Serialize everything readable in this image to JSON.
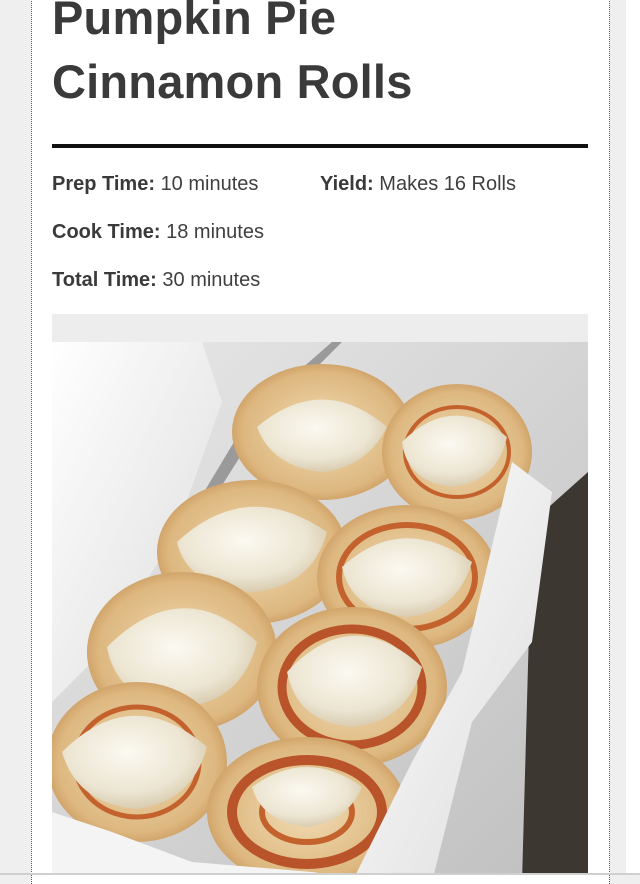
{
  "recipe": {
    "title_line1": "Pumpkin Pie",
    "title_line2": "Cinnamon Rolls",
    "prep_label": "Prep Time:",
    "prep_value": "10 minutes",
    "yield_label": "Yield:",
    "yield_value": "Makes 16 Rolls",
    "cook_label": "Cook Time:",
    "cook_value": "18 minutes",
    "total_label": "Total Time:",
    "total_value": "30 minutes"
  },
  "colors": {
    "title": "#3a3a3a",
    "rule": "#111111",
    "frame_bg": "#ededed",
    "icing": "#f2eee2",
    "pumpkin": "#c4622e",
    "dough": "#e6c795"
  },
  "photo": {
    "icon": "cinnamon-rolls-photo"
  }
}
